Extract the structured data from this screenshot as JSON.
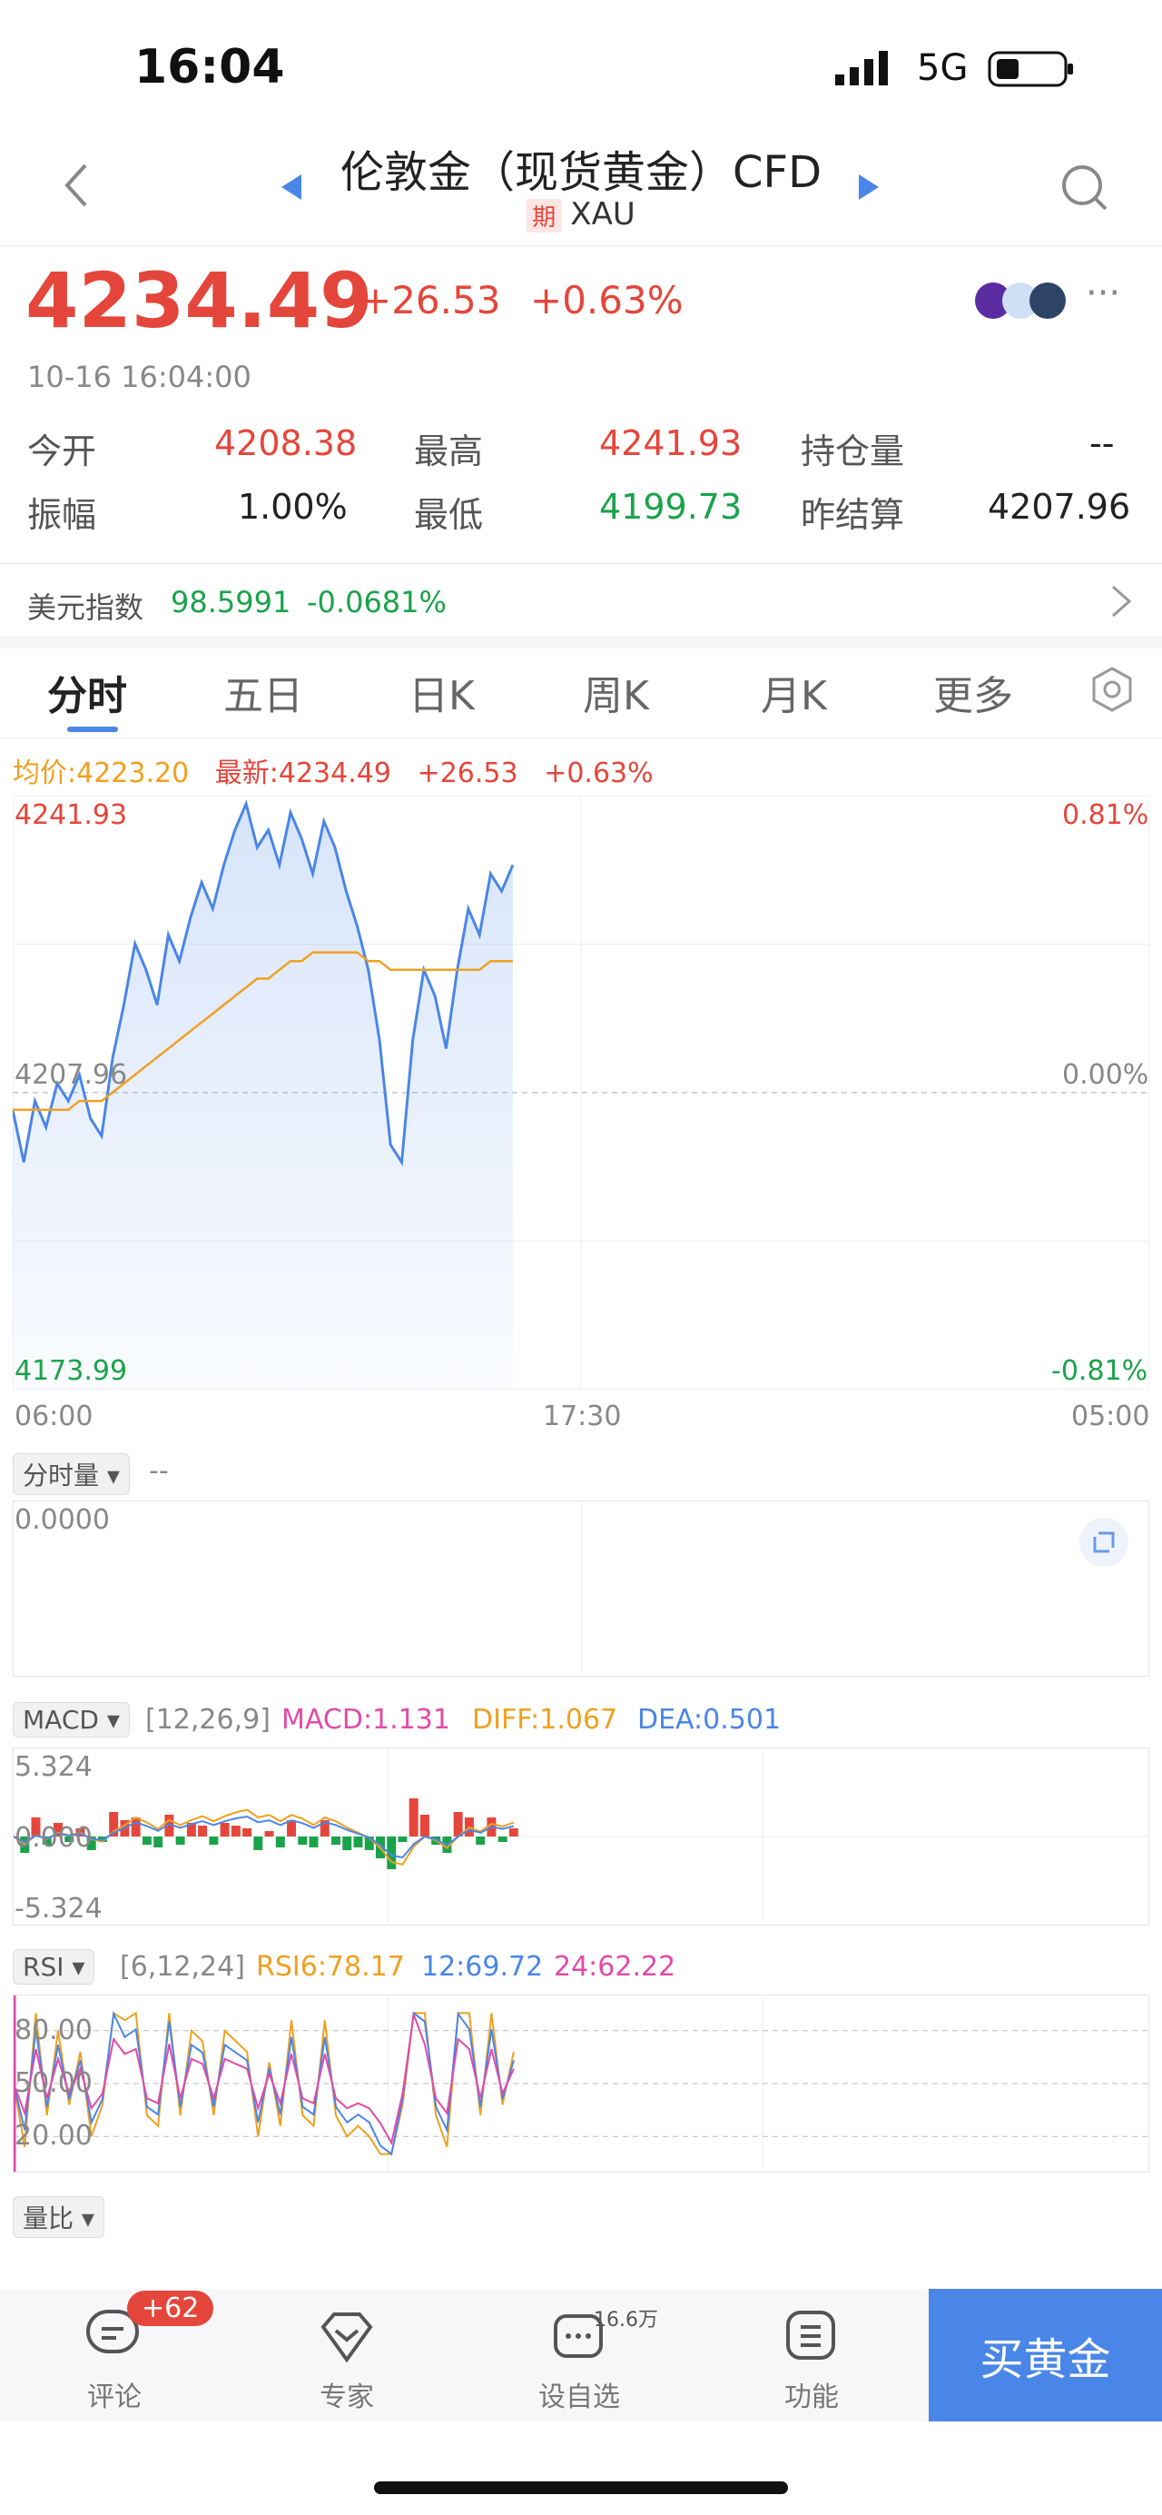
{
  "status_bar": {
    "time": "16:04",
    "network": "5G"
  },
  "nav": {
    "title": "伦敦金（现货黄金）CFD",
    "badge": "期",
    "symbol": "XAU"
  },
  "quote": {
    "price": "4234.49",
    "change": "+26.53",
    "change_pct": "+0.63%",
    "timestamp": "10-16 16:04:00",
    "open_label": "今开",
    "open": "4208.38",
    "high_label": "最高",
    "high": "4241.93",
    "oi_label": "持仓量",
    "oi": "--",
    "amp_label": "振幅",
    "amp": "1.00%",
    "low_label": "最低",
    "low": "4199.73",
    "prev_label": "昨结算",
    "prev": "4207.96"
  },
  "dxy": {
    "label": "美元指数",
    "value": "98.5991",
    "change": "-0.0681%"
  },
  "tabs": [
    "分时",
    "五日",
    "日K",
    "周K",
    "月K",
    "更多"
  ],
  "chart_header": {
    "avg": "均价:4223.20",
    "latest": "最新:4234.49",
    "change": "+26.53",
    "pct": "+0.63%"
  },
  "volume": {
    "label": "分时量",
    "value": "--",
    "axis": "0.0000"
  },
  "macd": {
    "label": "MACD",
    "params": "[12,26,9]",
    "macd": "MACD:1.131",
    "diff": "DIFF:1.067",
    "dea": "DEA:0.501",
    "ymax": "5.324",
    "ymid": "0.000",
    "ymin": "-5.324"
  },
  "rsi": {
    "label": "RSI",
    "params": "[6,12,24]",
    "rsi6": "RSI6:78.17",
    "rsi12": "12:69.72",
    "rsi24": "24:62.22",
    "t80": "80.00",
    "t50": "50.00",
    "t20": "20.00"
  },
  "ratio": {
    "label": "量比"
  },
  "bottom": {
    "comment": "评论",
    "comment_badge": "+62",
    "expert": "专家",
    "watch": "设自选",
    "watch_badge": "16.6万",
    "func": "功能",
    "buy": "买黄金"
  },
  "chart_data": {
    "type": "line",
    "x_ticks": [
      "06:00",
      "17:30",
      "05:00"
    ],
    "y_left": {
      "max": "4241.93",
      "ref": "4207.96",
      "min": "4173.99"
    },
    "y_right": {
      "max": "0.81%",
      "ref": "0.00%",
      "min": "-0.81%"
    },
    "ylim": [
      4173.99,
      4241.93
    ],
    "reference": 4207.96,
    "series": [
      {
        "name": "最新",
        "color": "#4a86e8",
        "values": [
          4206,
          4200,
          4207,
          4204,
          4209,
          4207,
          4210,
          4205,
          4203,
          4212,
          4218,
          4225,
          4222,
          4218,
          4226,
          4223,
          4228,
          4232,
          4229,
          4234,
          4238,
          4241,
          4236,
          4238,
          4234,
          4240,
          4237,
          4233,
          4239,
          4236,
          4231,
          4227,
          4222,
          4214,
          4202,
          4200,
          4214,
          4222,
          4219,
          4213,
          4222,
          4229,
          4226,
          4233,
          4231,
          4234
        ]
      },
      {
        "name": "均价",
        "color": "#f0a020",
        "values": [
          4206,
          4206,
          4206,
          4206,
          4206,
          4206,
          4207,
          4207,
          4207,
          4208,
          4209,
          4210,
          4211,
          4212,
          4213,
          4214,
          4215,
          4216,
          4217,
          4218,
          4219,
          4220,
          4221,
          4221,
          4222,
          4223,
          4223,
          4224,
          4224,
          4224,
          4224,
          4224,
          4223,
          4223,
          4222,
          4222,
          4222,
          4222,
          4222,
          4222,
          4222,
          4222,
          4222,
          4223,
          4223,
          4223
        ]
      }
    ],
    "colors": {
      "up": "#e5463b",
      "down": "#1aa34a",
      "accent": "#4a86e8"
    }
  }
}
